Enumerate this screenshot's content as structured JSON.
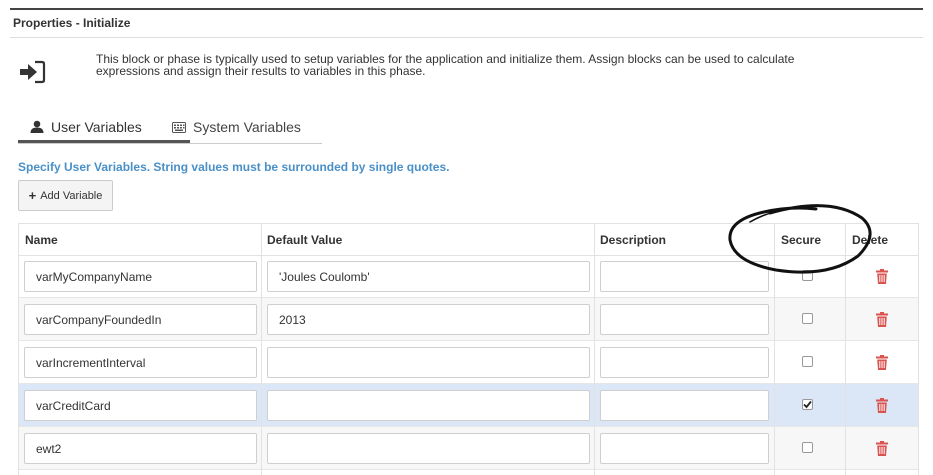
{
  "panel": {
    "title": "Properties - Initialize",
    "description": "This block or phase is typically used to setup variables for the application and initialize them. Assign blocks can be used to calculate expressions and assign their results to variables in this phase."
  },
  "tabs": [
    {
      "label": "User Variables",
      "icon": "user-icon",
      "active": true
    },
    {
      "label": "System Variables",
      "icon": "keyboard-icon",
      "active": false
    }
  ],
  "hint": "Specify User Variables. String values must be surrounded by single quotes.",
  "toolbar": {
    "add_label": "Add Variable"
  },
  "table": {
    "columns": [
      "Name",
      "Default Value",
      "Description",
      "Secure",
      "Delete"
    ],
    "rows": [
      {
        "name": "varMyCompanyName",
        "default": "'Joules Coulomb'",
        "description": "",
        "secure": false
      },
      {
        "name": "varCompanyFoundedIn",
        "default": "2013",
        "description": "",
        "secure": false
      },
      {
        "name": "varIncrementInterval",
        "default": "",
        "description": "",
        "secure": false
      },
      {
        "name": "varCreditCard",
        "default": "",
        "description": "",
        "secure": true
      },
      {
        "name": "ewt2",
        "default": "",
        "description": "",
        "secure": false
      }
    ]
  },
  "colors": {
    "hint": "#4a90c8",
    "selected_row": "#dbe6f7",
    "delete_icon": "#d9534f"
  }
}
